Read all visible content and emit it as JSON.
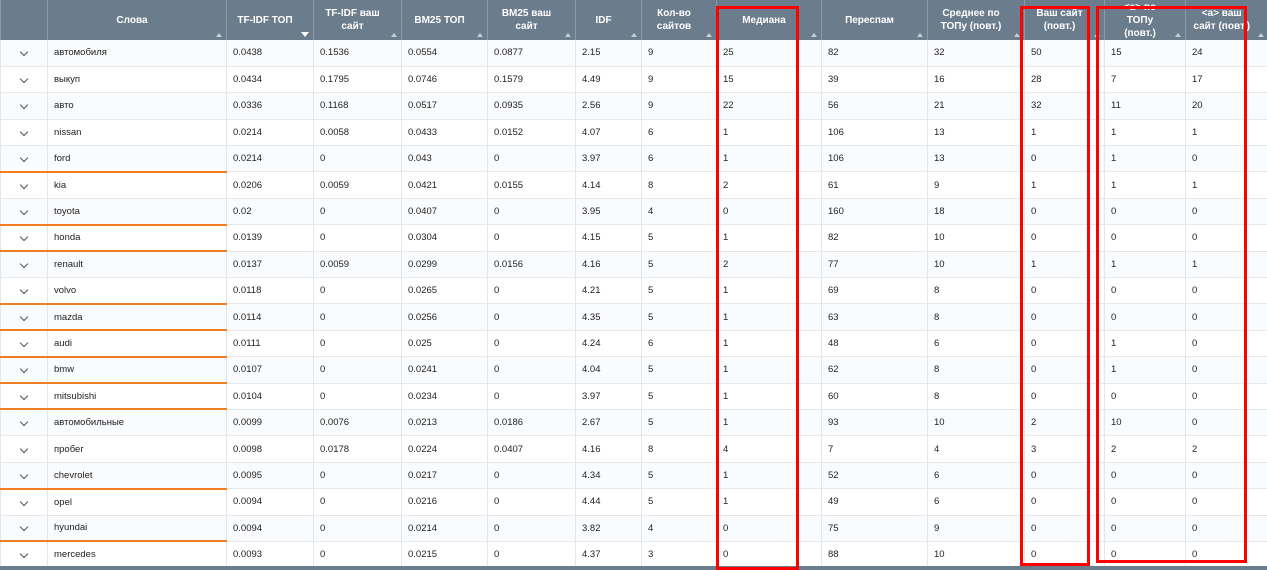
{
  "columns": [
    {
      "key": "expand",
      "label": ""
    },
    {
      "key": "word",
      "label": "Слова"
    },
    {
      "key": "tfidf_top",
      "label": "TF-IDF ТОП"
    },
    {
      "key": "tfidf_site",
      "label": "TF-IDF ваш сайт"
    },
    {
      "key": "bm25_top",
      "label": "BM25 ТОП"
    },
    {
      "key": "bm25_site",
      "label": "BM25 ваш сайт"
    },
    {
      "key": "idf",
      "label": "IDF"
    },
    {
      "key": "sites",
      "label": "Кол-во сайтов"
    },
    {
      "key": "median",
      "label": "Медиана"
    },
    {
      "key": "spam",
      "label": "Переспам"
    },
    {
      "key": "avg_top",
      "label": "Среднее по ТОПу (повт.)"
    },
    {
      "key": "your_site",
      "label": "Ваш сайт (повт.)"
    },
    {
      "key": "a_top",
      "label": "<a> по ТОПу (повт.)"
    },
    {
      "key": "a_site",
      "label": "<a> ваш сайт (повт.)"
    }
  ],
  "rows": [
    [
      "автомобиля",
      "0.0438",
      "0.1536",
      "0.0554",
      "0.0877",
      "2.15",
      "9",
      "25",
      "82",
      "32",
      "50",
      "15",
      "24"
    ],
    [
      "выкуп",
      "0.0434",
      "0.1795",
      "0.0746",
      "0.1579",
      "4.49",
      "9",
      "15",
      "39",
      "16",
      "28",
      "7",
      "17"
    ],
    [
      "авто",
      "0.0336",
      "0.1168",
      "0.0517",
      "0.0935",
      "2.56",
      "9",
      "22",
      "56",
      "21",
      "32",
      "11",
      "20"
    ],
    [
      "nissan",
      "0.0214",
      "0.0058",
      "0.0433",
      "0.0152",
      "4.07",
      "6",
      "1",
      "106",
      "13",
      "1",
      "1",
      "1"
    ],
    [
      "ford",
      "0.0214",
      "0",
      "0.043",
      "0",
      "3.97",
      "6",
      "1",
      "106",
      "13",
      "0",
      "1",
      "0"
    ],
    [
      "kia",
      "0.0206",
      "0.0059",
      "0.0421",
      "0.0155",
      "4.14",
      "8",
      "2",
      "61",
      "9",
      "1",
      "1",
      "1"
    ],
    [
      "toyota",
      "0.02",
      "0",
      "0.0407",
      "0",
      "3.95",
      "4",
      "0",
      "160",
      "18",
      "0",
      "0",
      "0"
    ],
    [
      "honda",
      "0.0139",
      "0",
      "0.0304",
      "0",
      "4.15",
      "5",
      "1",
      "82",
      "10",
      "0",
      "0",
      "0"
    ],
    [
      "renault",
      "0.0137",
      "0.0059",
      "0.0299",
      "0.0156",
      "4.16",
      "5",
      "2",
      "77",
      "10",
      "1",
      "1",
      "1"
    ],
    [
      "volvo",
      "0.0118",
      "0",
      "0.0265",
      "0",
      "4.21",
      "5",
      "1",
      "69",
      "8",
      "0",
      "0",
      "0"
    ],
    [
      "mazda",
      "0.0114",
      "0",
      "0.0256",
      "0",
      "4.35",
      "5",
      "1",
      "63",
      "8",
      "0",
      "0",
      "0"
    ],
    [
      "audi",
      "0.0111",
      "0",
      "0.025",
      "0",
      "4.24",
      "6",
      "1",
      "48",
      "6",
      "0",
      "1",
      "0"
    ],
    [
      "bmw",
      "0.0107",
      "0",
      "0.0241",
      "0",
      "4.04",
      "5",
      "1",
      "62",
      "8",
      "0",
      "1",
      "0"
    ],
    [
      "mitsubishi",
      "0.0104",
      "0",
      "0.0234",
      "0",
      "3.97",
      "5",
      "1",
      "60",
      "8",
      "0",
      "0",
      "0"
    ],
    [
      "автомобильные",
      "0.0099",
      "0.0076",
      "0.0213",
      "0.0186",
      "2.67",
      "5",
      "1",
      "93",
      "10",
      "2",
      "10",
      "0"
    ],
    [
      "пробег",
      "0.0098",
      "0.0178",
      "0.0224",
      "0.0407",
      "4.16",
      "8",
      "4",
      "7",
      "4",
      "3",
      "2",
      "2"
    ],
    [
      "chevrolet",
      "0.0095",
      "0",
      "0.0217",
      "0",
      "4.34",
      "5",
      "1",
      "52",
      "6",
      "0",
      "0",
      "0"
    ],
    [
      "opel",
      "0.0094",
      "0",
      "0.0216",
      "0",
      "4.44",
      "5",
      "1",
      "49",
      "6",
      "0",
      "0",
      "0"
    ],
    [
      "hyundai",
      "0.0094",
      "0",
      "0.0214",
      "0",
      "3.82",
      "4",
      "0",
      "75",
      "9",
      "0",
      "0",
      "0"
    ],
    [
      "mercedes",
      "0.0093",
      "0",
      "0.0215",
      "0",
      "4.37",
      "3",
      "0",
      "88",
      "10",
      "0",
      "0",
      "0"
    ]
  ],
  "orange_underlined_rows": [
    4,
    6,
    7,
    9,
    10,
    11,
    12,
    13,
    16,
    18,
    19
  ],
  "sorted_column": "tfidf_top",
  "colors": {
    "header_bg": "#6b7c8c",
    "highlight_border": "#ff0000",
    "row_underline": "#ef7d22"
  }
}
